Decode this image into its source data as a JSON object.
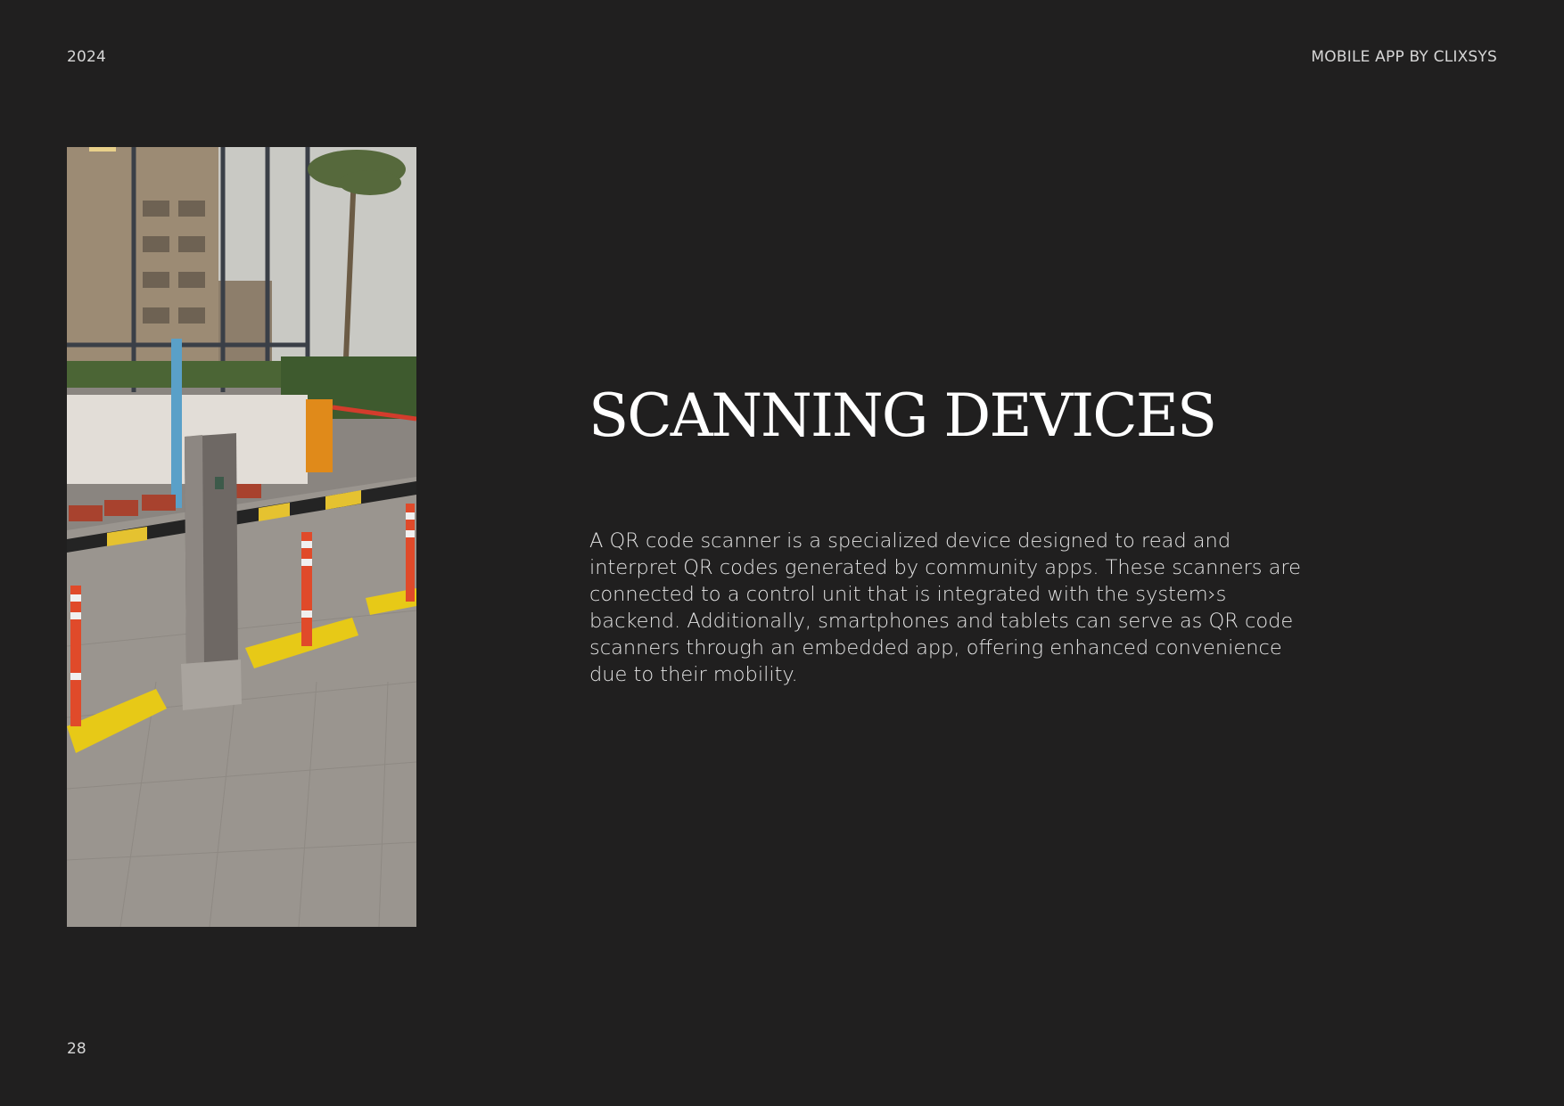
{
  "header": {
    "year": "2024",
    "brand": "MOBILE APP BY CLIXSYS"
  },
  "main": {
    "title": "SCANNING DEVICES",
    "body": "A QR code scanner is a specialized device designed to read and interpret QR codes generated by community apps. These scanners are connected to a control unit that is integrated with the system›s backend. Additionally, smartphones and tablets can serve as QR code scanners through an embedded app, offering enhanced convenience due to their mobility."
  },
  "footer": {
    "page_number": "28"
  },
  "colors": {
    "background": "#201f1f",
    "text": "#e8e8e8"
  }
}
